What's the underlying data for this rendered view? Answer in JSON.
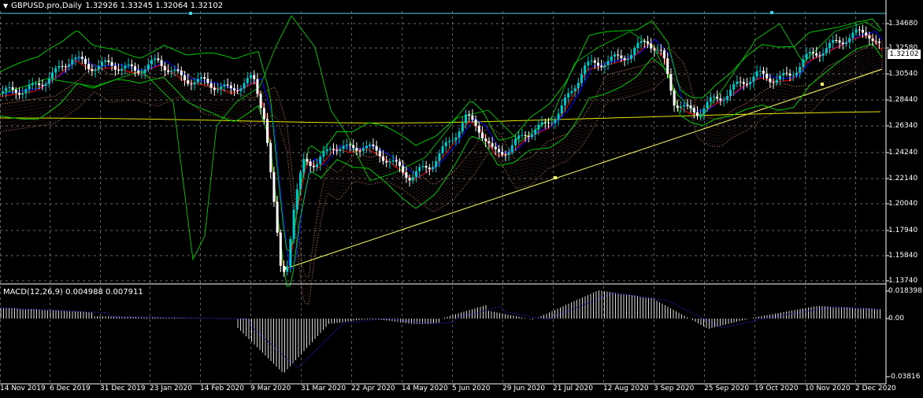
{
  "header": {
    "symbol": "GBPUSD.pro,Daily",
    "ohlc": "1.32926 1.33245 1.32064 1.32102"
  },
  "macd": {
    "label": "MACD(12,26,9) 0.004988 0.007911",
    "axis_labels": [
      "0.018398",
      "0.00",
      "-0.03816"
    ]
  },
  "price_axis": {
    "labels": [
      "1.34680",
      "1.32580",
      "1.30540",
      "1.28440",
      "1.26340",
      "1.24240",
      "1.22140",
      "1.20040",
      "1.17940",
      "1.15840",
      "1.13740"
    ],
    "current_price": "1.32102"
  },
  "time_axis": {
    "labels": [
      "14 Nov 2019",
      "6 Dec 2019",
      "31 Dec 2019",
      "23 Jan 2020",
      "14 Feb 2020",
      "9 Mar 2020",
      "31 Mar 2020",
      "22 Apr 2020",
      "14 May 2020",
      "5 Jun 2020",
      "29 Jun 2020",
      "21 Jul 2020",
      "12 Aug 2020",
      "3 Sep 2020",
      "25 Sep 2020",
      "19 Oct 2020",
      "10 Nov 2020",
      "2 Dec 2020"
    ]
  },
  "colors": {
    "background": "#000000",
    "grid": "#8a8a8a",
    "bull_candle": "#00c8c8",
    "bear_candle": "#ffffff",
    "bollinger": "#00c800",
    "ma_fast": "#ff0000",
    "ma_slow": "#0000ff",
    "ma_long": "#e6e600",
    "trendline": "#ffff66",
    "resistance": "#4ad0e0",
    "cloud": "#f4a070",
    "macd_hist": "#dcdcdc",
    "macd_signal": "#2020c0"
  }
}
